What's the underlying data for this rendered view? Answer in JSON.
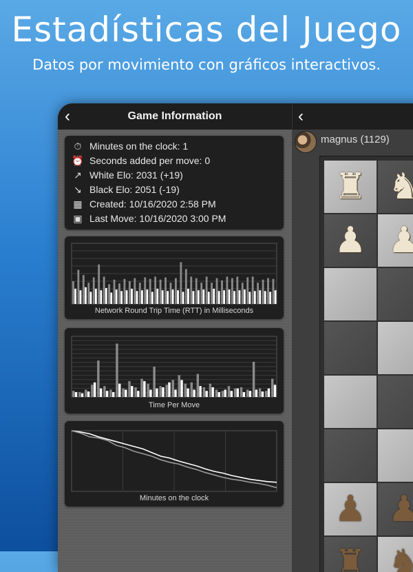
{
  "hero": {
    "title": "Estadísticas del Juego",
    "subtitle": "Datos por movimiento con gráficos interactivos."
  },
  "header": {
    "title": "Game Information",
    "back_icon": "chevron-left-icon"
  },
  "info": [
    {
      "icon": "stopwatch-icon",
      "glyph": "⏱",
      "text": "Minutes on the clock: 1"
    },
    {
      "icon": "alarm-plus-icon",
      "glyph": "⏰",
      "text": "Seconds added per move: 0"
    },
    {
      "icon": "trend-up-icon",
      "glyph": "↗",
      "text": "White Elo: 2031  (+19)"
    },
    {
      "icon": "trend-down-icon",
      "glyph": "↘",
      "text": "Black Elo: 2051  (-19)"
    },
    {
      "icon": "calendar-icon",
      "glyph": "▦",
      "text": "Created: 10/16/2020 2:58 PM"
    },
    {
      "icon": "calendar-user-icon",
      "glyph": "▣",
      "text": "Last Move: 10/16/2020 3:00 PM"
    }
  ],
  "player": {
    "name": "magnus (1129)"
  },
  "chart_data": [
    {
      "type": "bar",
      "title": "Network Round Trip Time (RTT) in Milliseconds",
      "grid": true,
      "series": [
        {
          "values": [
            30,
            45,
            38,
            28,
            35,
            52,
            36,
            26,
            32,
            27,
            33,
            30,
            34,
            28,
            35,
            33,
            36,
            32,
            35,
            28,
            34,
            55,
            46,
            36,
            34,
            28,
            36,
            28,
            34,
            31,
            36,
            34,
            36,
            28,
            35,
            36,
            28,
            32,
            34,
            33
          ]
        },
        {
          "values": [
            20,
            18,
            22,
            16,
            20,
            18,
            21,
            15,
            19,
            17,
            18,
            20,
            17,
            18,
            19,
            16,
            20,
            18,
            17,
            19,
            18,
            16,
            20,
            17,
            18,
            19,
            16,
            20,
            17,
            18,
            19,
            17,
            18,
            19,
            16,
            17,
            18,
            17,
            16,
            18
          ]
        }
      ]
    },
    {
      "type": "bar",
      "title": "Time Per Move",
      "grid": true,
      "series": [
        {
          "values": [
            10,
            8,
            12,
            20,
            60,
            18,
            12,
            88,
            14,
            26,
            16,
            30,
            22,
            50,
            18,
            20,
            28,
            36,
            22,
            24,
            38,
            16,
            22,
            12,
            10,
            18,
            14,
            16,
            12,
            58,
            14,
            10,
            30
          ]
        },
        {
          "values": [
            8,
            6,
            9,
            24,
            14,
            10,
            8,
            22,
            12,
            18,
            10,
            26,
            12,
            14,
            16,
            24,
            12,
            28,
            14,
            12,
            18,
            10,
            16,
            8,
            12,
            10,
            14,
            8,
            10,
            12,
            9,
            14,
            20
          ]
        }
      ]
    },
    {
      "type": "line",
      "title": "Minutes on the clock",
      "grid": true,
      "series": [
        {
          "values": [
            1.0,
            0.98,
            0.95,
            0.9,
            0.86,
            0.82,
            0.78,
            0.74,
            0.7,
            0.64,
            0.58,
            0.55,
            0.5,
            0.46,
            0.42,
            0.37,
            0.33,
            0.3,
            0.26,
            0.23,
            0.2,
            0.18,
            0.16,
            0.15
          ]
        },
        {
          "values": [
            1.0,
            0.96,
            0.9,
            0.88,
            0.84,
            0.76,
            0.72,
            0.66,
            0.62,
            0.58,
            0.52,
            0.48,
            0.45,
            0.4,
            0.36,
            0.31,
            0.27,
            0.23,
            0.2,
            0.18,
            0.15,
            0.13,
            0.1,
            0.06
          ]
        }
      ]
    }
  ],
  "colors": {
    "bar_light": "#ffffff",
    "bar_dim": "#8a8a8a",
    "line_a": "#ffffff",
    "line_b": "#9a9a9a"
  }
}
